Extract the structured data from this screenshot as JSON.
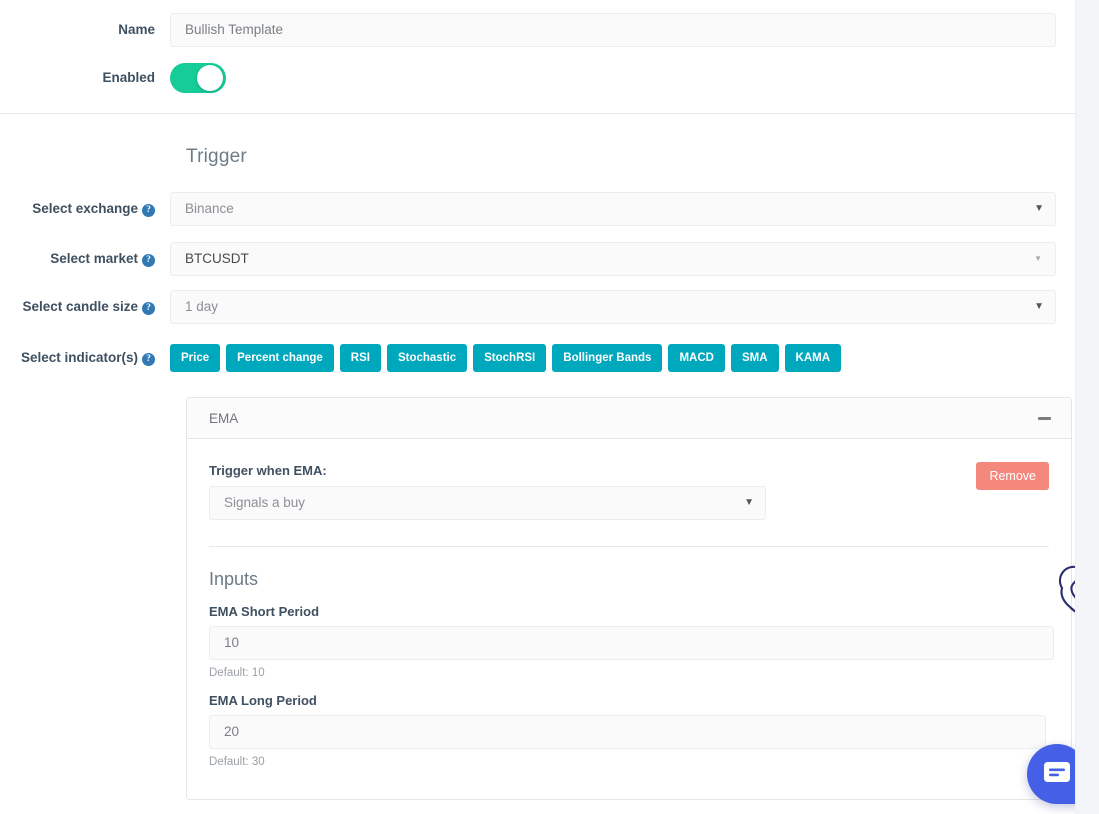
{
  "form": {
    "name_label": "Name",
    "name_value": "Bullish Template",
    "enabled_label": "Enabled",
    "enabled_state": "on"
  },
  "trigger": {
    "heading": "Trigger",
    "exchange": {
      "label": "Select exchange",
      "help": "?",
      "value": "Binance",
      "caret": "▼"
    },
    "market": {
      "label": "Select market",
      "help": "?",
      "value": "BTCUSDT",
      "caret": "▼"
    },
    "candle": {
      "label": "Select candle size",
      "help": "?",
      "value": "1 day",
      "caret": "▼"
    },
    "indicators": {
      "label": "Select indicator(s)",
      "help": "?",
      "buttons": [
        "Price",
        "Percent change",
        "RSI",
        "Stochastic",
        "StochRSI",
        "Bollinger Bands",
        "MACD",
        "SMA",
        "KAMA"
      ]
    }
  },
  "ema_panel": {
    "title": "EMA",
    "collapse_icon": "minus-icon",
    "trigger_when_label": "Trigger when EMA:",
    "condition_value": "Signals a buy",
    "condition_caret": "▼",
    "remove_label": "Remove",
    "inputs_heading": "Inputs",
    "fields": [
      {
        "label": "EMA Short Period",
        "value": "10",
        "default_text": "Default: 10"
      },
      {
        "label": "EMA Long Period",
        "value": "20",
        "default_text": "Default: 30"
      }
    ]
  },
  "chat": {
    "icon": "chat-bubble-icon"
  },
  "colors": {
    "accent_teal": "#00a8bd",
    "toggle_green": "#16cc99",
    "remove_salmon": "#f4887c",
    "help_blue": "#3079b5",
    "chat_blue": "#4560e6",
    "line_art_navy": "#2b2f6e"
  }
}
